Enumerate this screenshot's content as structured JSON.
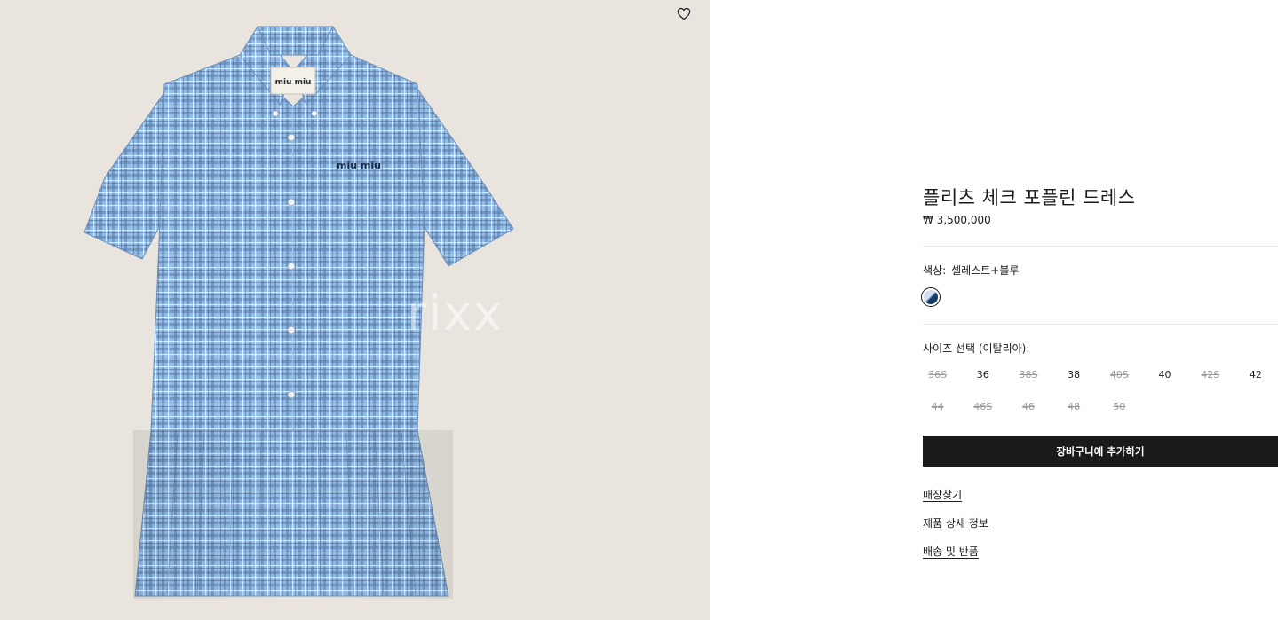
{
  "gallery": {
    "watermark": "rixx",
    "wishlist_icon": "heart-outline-icon",
    "background_color": "#e9e5de",
    "product_color": "#8fbde8",
    "collar_label_text": "miu miu",
    "chest_logo_text": "miu miu"
  },
  "product": {
    "title": "플리츠 체크 포플린 드레스",
    "price": "₩ 3,500,000",
    "color_label": "색상:",
    "color_value": "셀레스트+블루",
    "size_label": "사이즈 선택 (이탈리아):",
    "sizes": [
      {
        "label": "36S",
        "available": false
      },
      {
        "label": "36",
        "available": true
      },
      {
        "label": "38S",
        "available": false
      },
      {
        "label": "38",
        "available": true
      },
      {
        "label": "40S",
        "available": false
      },
      {
        "label": "40",
        "available": true
      },
      {
        "label": "42S",
        "available": false
      },
      {
        "label": "42",
        "available": true
      },
      {
        "label": "44",
        "available": false
      },
      {
        "label": "46S",
        "available": false
      },
      {
        "label": "46",
        "available": false
      },
      {
        "label": "48",
        "available": false
      },
      {
        "label": "50",
        "available": false
      }
    ],
    "add_to_cart": "장바구니에 추가하기",
    "links": {
      "find_store": "매장찾기",
      "product_details": "제품 상세 정보",
      "shipping_returns": "배송 및 반품"
    }
  }
}
